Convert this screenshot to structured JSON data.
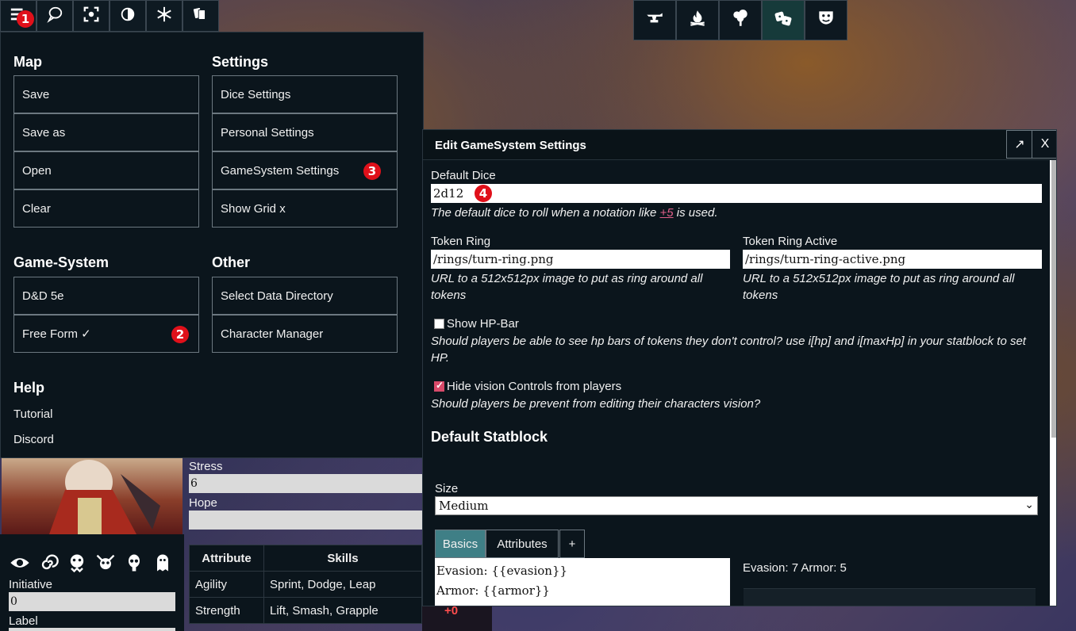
{
  "toolbar": {
    "left_icons": [
      "menu-icon",
      "chat-icon",
      "focus-icon",
      "contrast-icon",
      "snowflake-icon",
      "cards-icon"
    ],
    "center_icons": [
      "anvil-icon",
      "campfire-icon",
      "tree-icon",
      "dice-icon",
      "masks-icon"
    ],
    "active_center": "dice-icon",
    "badge_1": "1"
  },
  "menu": {
    "map_heading": "Map",
    "map_items": [
      "Save",
      "Save as",
      "Open",
      "Clear"
    ],
    "settings_heading": "Settings",
    "settings_items": [
      "Dice Settings",
      "Personal Settings",
      "GameSystem Settings",
      "Show Grid x"
    ],
    "game_system_heading": "Game-System",
    "game_system_items": [
      "D&D 5e",
      "Free Form ✓"
    ],
    "other_heading": "Other",
    "other_items": [
      "Select Data Directory",
      "Character Manager"
    ],
    "help_heading": "Help",
    "help_items": [
      "Tutorial",
      "Discord"
    ],
    "badge_2": "2",
    "badge_3": "3"
  },
  "character": {
    "stress_label": "Stress",
    "stress_value": "6",
    "hope_label": "Hope",
    "hope_value": "",
    "initiative_label": "Initiative",
    "initiative_value": "0",
    "label_label": "Label",
    "icons": [
      "eye-icon",
      "spiral-icon",
      "creature-icon",
      "horned-skull-icon",
      "skull-icon",
      "ghost-icon"
    ],
    "table_headers": [
      "Attribute",
      "Skills"
    ],
    "table_rows": [
      {
        "attribute": "Agility",
        "skills": "Sprint, Dodge, Leap"
      },
      {
        "attribute": "Strength",
        "skills": "Lift, Smash, Grapple"
      }
    ],
    "modifier": "+0"
  },
  "dialog": {
    "title": "Edit GameSystem Settings",
    "expand_label": "↗",
    "close_label": "X",
    "default_dice_label": "Default Dice",
    "default_dice_value": "2d12",
    "badge_4": "4",
    "default_dice_help_pre": "The default dice to roll when a notation like ",
    "default_dice_help_link": "+5",
    "default_dice_help_post": " is used.",
    "token_ring_label": "Token Ring",
    "token_ring_value": "/rings/turn-ring.png",
    "token_ring_help": "URL to a 512x512px image to put as ring around all tokens",
    "token_ring_active_label": "Token Ring Active",
    "token_ring_active_value": "/rings/turn-ring-active.png",
    "token_ring_active_help": "URL to a 512x512px image to put as ring around all tokens",
    "show_hp_label": "Show HP-Bar",
    "show_hp_checked": false,
    "show_hp_help": "Should players be able to see hp bars of tokens they don't control? use i[hp] and i[maxHp] in your statblock to set HP.",
    "hide_vision_label": "Hide vision Controls from players",
    "hide_vision_checked": true,
    "hide_vision_help": "Should players be prevent from editing their characters vision?",
    "statblock_heading": "Default Statblock",
    "size_label": "Size",
    "size_value": "Medium",
    "tabs": [
      "Basics",
      "Attributes",
      "+"
    ],
    "active_tab": "Basics",
    "template_lines": [
      "Evasion: {{evasion}}",
      "Armor: {{armor}}"
    ],
    "preview_text": "Evasion: 7 Armor: 5"
  },
  "colors": {
    "panel": "#0b151c",
    "badge": "#e0101a",
    "active_tab": "#3f7f86",
    "link_pink": "#e0608a"
  }
}
